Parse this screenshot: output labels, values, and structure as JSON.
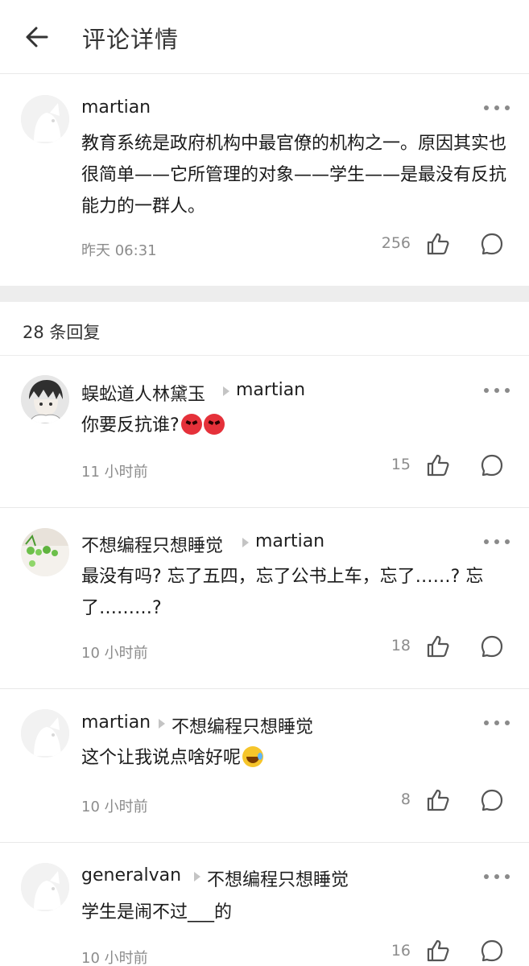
{
  "header": {
    "title": "评论详情",
    "back_icon": "arrow-left-icon"
  },
  "main_comment": {
    "username": "martian",
    "text": "教育系统是政府机构中最官僚的机构之一。原因其实也很简单——它所管理的对象——学生——是最没有反抗能力的一群人。",
    "time": "昨天 06:31",
    "likes": "256"
  },
  "replies_header": {
    "count_label": "28 条回复"
  },
  "replies": [
    {
      "username": "蜈蚣道人林黛玉",
      "reply_to": "martian",
      "text": "你要反抗谁?",
      "emojis": [
        "angry-face",
        "angry-face"
      ],
      "time": "11 小时前",
      "likes": "15"
    },
    {
      "username": "不想编程只想睡觉",
      "reply_to": "martian",
      "text": "最没有吗? 忘了五四，忘了公书上车，忘了……? 忘了………?",
      "time": "10 小时前",
      "likes": "18"
    },
    {
      "username": "martian",
      "reply_to": "不想编程只想睡觉",
      "text": "这个让我说点啥好呢",
      "emojis": [
        "laughing-tears-face"
      ],
      "time": "10 小时前",
      "likes": "8"
    },
    {
      "username": "generalvan",
      "reply_to": "不想编程只想睡觉",
      "text": "学生是闹不过___的",
      "time": "10 小时前",
      "likes": "16"
    }
  ],
  "colors": {
    "text": "#1a1a1a",
    "muted": "#8c8c8c",
    "divider": "#e9e9e9",
    "section_gap": "#ededed"
  }
}
